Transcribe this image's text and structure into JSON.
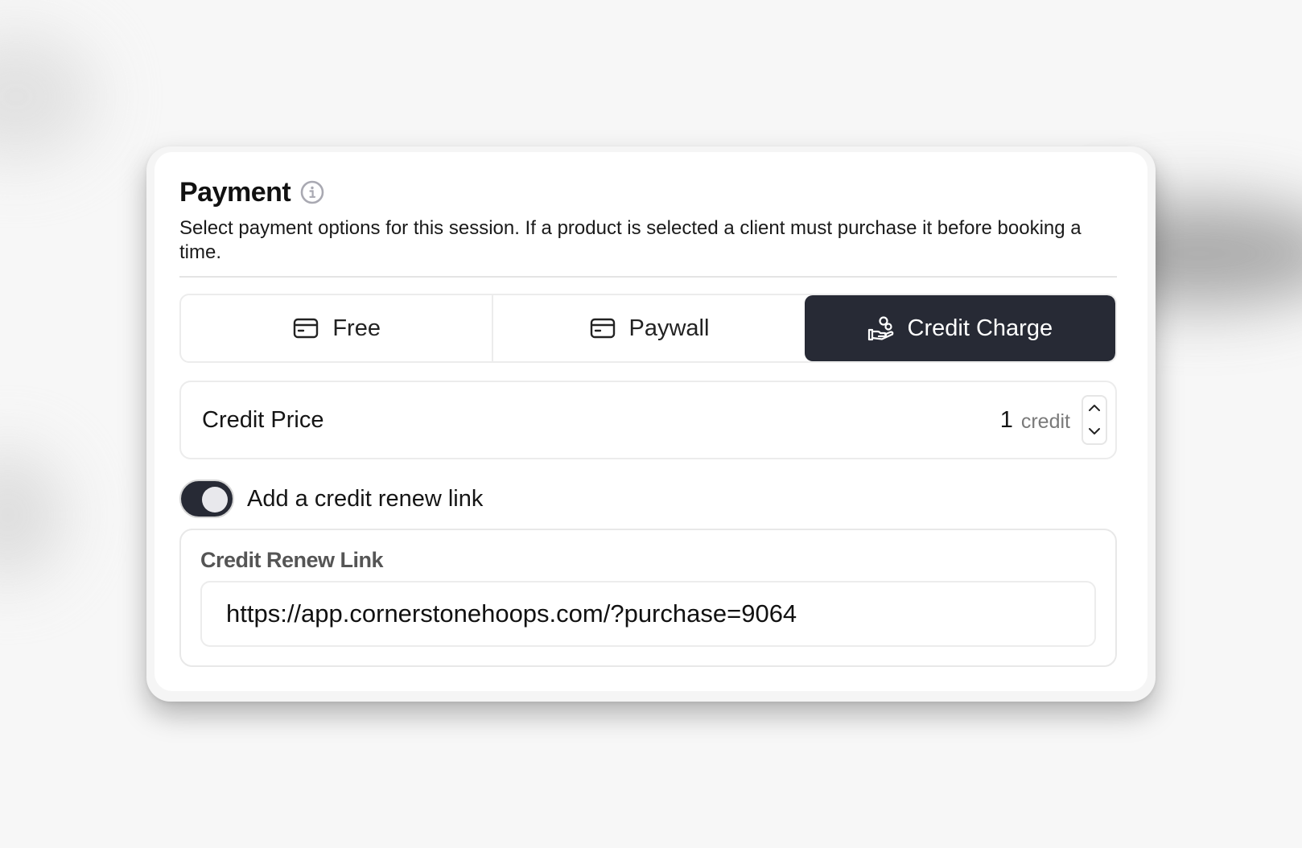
{
  "payment": {
    "title": "Payment",
    "description": "Select payment options for this session. If a product is selected a client must purchase it before booking a time."
  },
  "payment_options": {
    "free_label": "Free",
    "paywall_label": "Paywall",
    "credit_charge_label": "Credit Charge",
    "selected": "Credit Charge"
  },
  "credit_price": {
    "label": "Credit Price",
    "value": "1",
    "unit": "credit"
  },
  "renew_toggle": {
    "label": "Add a credit renew link",
    "enabled": true
  },
  "renew_link": {
    "label": "Credit Renew Link",
    "value": "https://app.cornerstonehoops.com/?purchase=9064"
  },
  "icons": {
    "info": "info-circle-icon",
    "free": "credit-card-icon",
    "paywall": "credit-card-icon",
    "credit_charge": "hand-coin-icon",
    "increment": "chevron-up-icon",
    "decrement": "chevron-down-icon"
  },
  "colors": {
    "active_segment": "#272a35",
    "toggle_on": "#272a35",
    "card_background": "#ffffff",
    "page_background": "#f7f7f7"
  }
}
